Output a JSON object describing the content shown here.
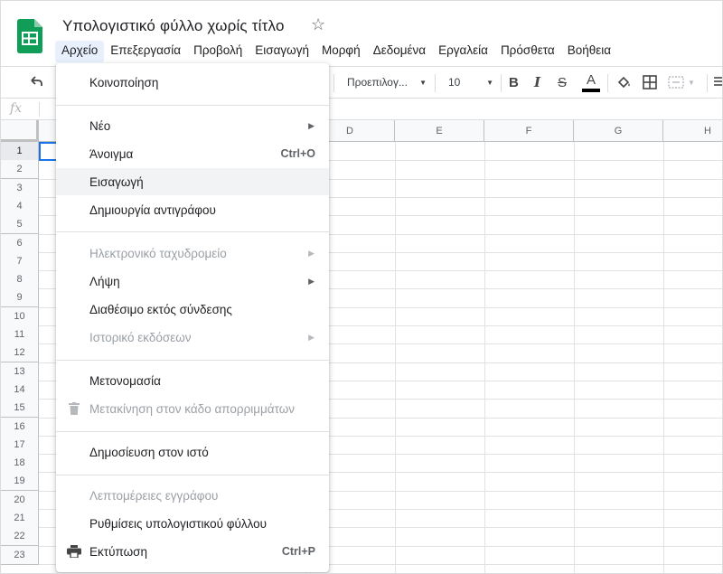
{
  "app": {
    "title": "Υπολογιστικό φύλλο χωρίς τίτλο",
    "accent": "#1a73e8",
    "logo_color": "#0f9d58"
  },
  "menubar": [
    "Αρχείο",
    "Επεξεργασία",
    "Προβολή",
    "Εισαγωγή",
    "Μορφή",
    "Δεδομένα",
    "Εργαλεία",
    "Πρόσθετα",
    "Βοήθεια"
  ],
  "toolbar": {
    "font": "Προεπιλογ...",
    "font_size": "10",
    "icons": [
      "undo-icon",
      "bold-icon",
      "italic-icon",
      "strikethrough-icon",
      "text-color-icon",
      "fill-color-icon",
      "borders-icon",
      "merge-cells-icon",
      "align-icon"
    ]
  },
  "formula_bar": {
    "fx": "fx"
  },
  "sheet": {
    "columns": [
      "D",
      "E",
      "F",
      "G",
      "H"
    ],
    "rows": [
      "1",
      "2",
      "3",
      "4",
      "5",
      "6",
      "7",
      "8",
      "9",
      "10",
      "11",
      "12",
      "13",
      "14",
      "15",
      "16",
      "17",
      "18",
      "19",
      "20",
      "21",
      "22",
      "23"
    ]
  },
  "file_menu": {
    "items": [
      {
        "label": "Κοινοποίηση"
      },
      {
        "label": "Νέο",
        "submenu": true
      },
      {
        "label": "Άνοιγμα",
        "shortcut": "Ctrl+O"
      },
      {
        "label": "Εισαγωγή",
        "hover": true
      },
      {
        "label": "Δημιουργία αντιγράφου"
      },
      {
        "label": "Ηλεκτρονικό ταχυδρομείο",
        "submenu": true,
        "disabled": true
      },
      {
        "label": "Λήψη",
        "submenu": true
      },
      {
        "label": "Διαθέσιμο εκτός σύνδεσης"
      },
      {
        "label": "Ιστορικό εκδόσεων",
        "submenu": true,
        "disabled": true
      },
      {
        "label": "Μετονομασία"
      },
      {
        "label": "Μετακίνηση στον κάδο απορριμμάτων",
        "disabled": true,
        "icon": "trash-icon"
      },
      {
        "label": "Δημοσίευση στον ιστό"
      },
      {
        "label": "Λεπτομέρειες εγγράφου",
        "disabled": true
      },
      {
        "label": "Ρυθμίσεις υπολογιστικού φύλλου"
      },
      {
        "label": "Εκτύπωση",
        "shortcut": "Ctrl+P",
        "icon": "print-icon"
      }
    ]
  }
}
